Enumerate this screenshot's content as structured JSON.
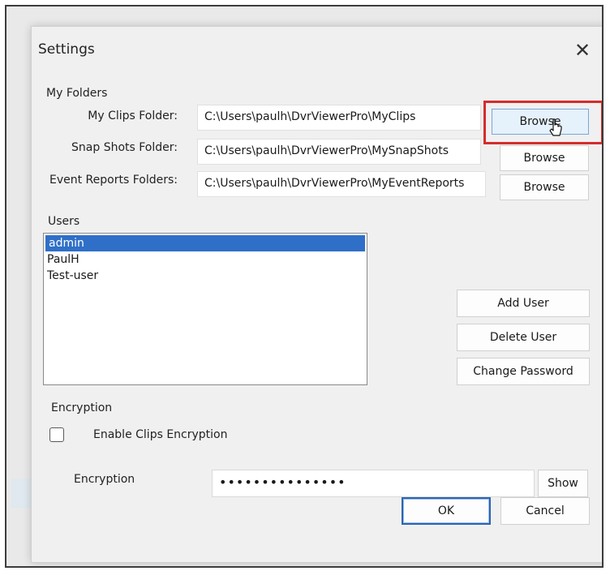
{
  "dialog": {
    "title": "Settings"
  },
  "folders": {
    "group_label": "My Folders",
    "rows": [
      {
        "label": "My Clips Folder:",
        "path": "C:\\Users\\paulh\\DvrViewerPro\\MyClips",
        "button": "Browse"
      },
      {
        "label": "Snap Shots Folder:",
        "path": "C:\\Users\\paulh\\DvrViewerPro\\MySnapShots",
        "button": "Browse"
      },
      {
        "label": "Event Reports Folders:",
        "path": "C:\\Users\\paulh\\DvrViewerPro\\MyEventReports",
        "button": "Browse"
      }
    ]
  },
  "users": {
    "group_label": "Users",
    "items": [
      "admin",
      "PaulH",
      "Test-user"
    ],
    "selected": "admin",
    "add_label": "Add User",
    "delete_label": "Delete User",
    "change_password_label": "Change Password"
  },
  "encryption": {
    "group_label": "Encryption",
    "checkbox_label": "Enable Clips Encryption",
    "checked": false,
    "field_label": "Encryption",
    "masked_value": "•••••••••••••••",
    "show_label": "Show"
  },
  "footer": {
    "ok_label": "OK",
    "cancel_label": "Cancel"
  },
  "colors": {
    "selection": "#2f6fc8",
    "highlight": "#d62c2c",
    "ok_border": "#2d66b3"
  }
}
